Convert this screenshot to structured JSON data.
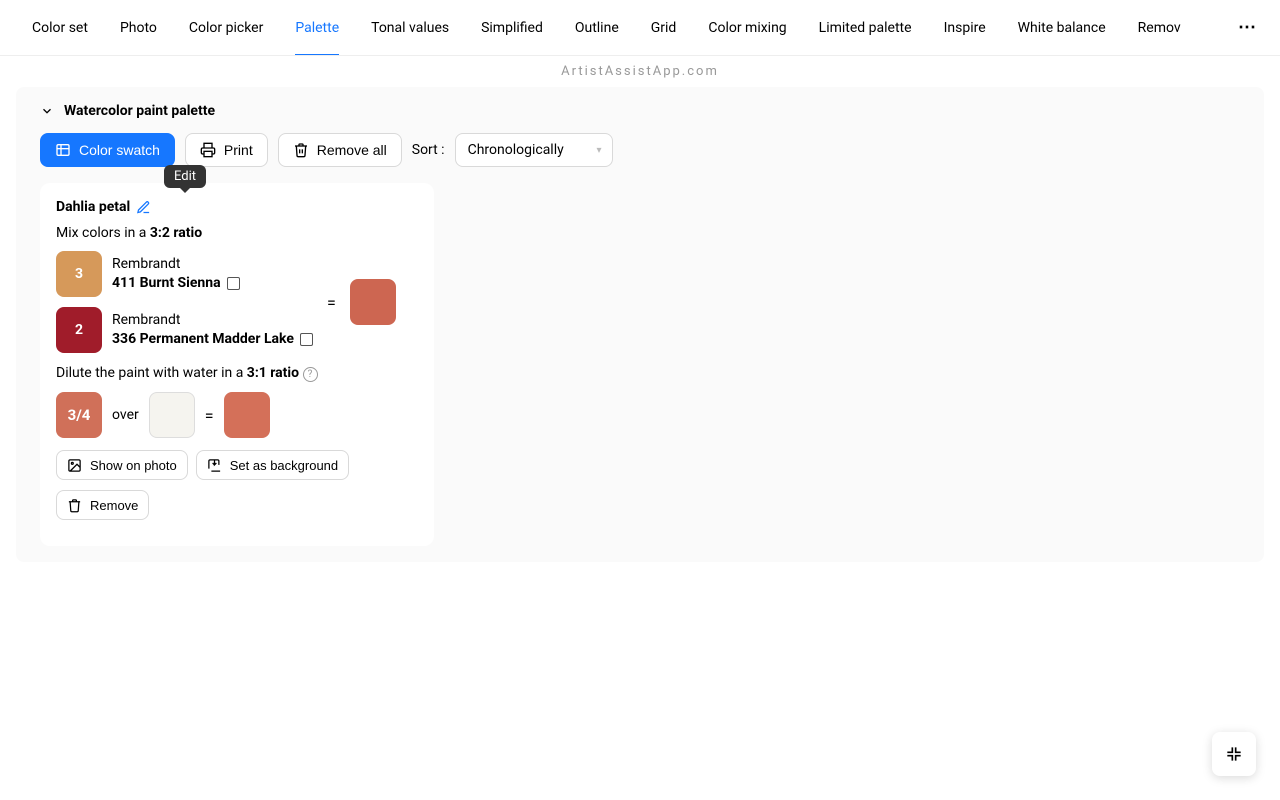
{
  "tabs": {
    "items": [
      "Color set",
      "Photo",
      "Color picker",
      "Palette",
      "Tonal values",
      "Simplified",
      "Outline",
      "Grid",
      "Color mixing",
      "Limited palette",
      "Inspire",
      "White balance",
      "Remov"
    ],
    "active_index": 3
  },
  "subtitle": "ArtistAssistApp.com",
  "panel": {
    "title": "Watercolor paint palette"
  },
  "toolbar": {
    "color_swatch": "Color swatch",
    "print": "Print",
    "remove_all": "Remove all",
    "sort_label": "Sort :",
    "sort_value": "Chronologically",
    "tooltip": "Edit"
  },
  "card": {
    "title": "Dahlia petal",
    "mix_prefix": "Mix colors in a ",
    "mix_ratio": "3:2 ratio",
    "paints": [
      {
        "qty": "3",
        "brand": "Rembrandt",
        "name": "411 Burnt Sienna",
        "color": "#d6995a"
      },
      {
        "qty": "2",
        "brand": "Rembrandt",
        "name": "336 Permanent Madder Lake",
        "color": "#a01c2a"
      }
    ],
    "equals": "=",
    "result_color": "#cd6651",
    "dilute_prefix": "Dilute the paint with water in a ",
    "dilute_ratio": "3:1 ratio",
    "consistency": "3/4",
    "consistency_color": "#d07059",
    "over_label": "over",
    "paper_color": "#f5f4ef",
    "final_color": "#d47059",
    "show_on_photo": "Show on photo",
    "set_as_background": "Set as background",
    "remove": "Remove"
  }
}
